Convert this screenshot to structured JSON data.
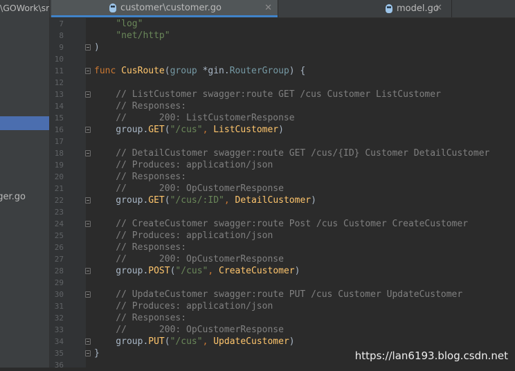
{
  "sidebar": {
    "path_fragment": "\\GOWork\\sr",
    "file_fragment": "ger.go"
  },
  "tabs": [
    {
      "label": "customer\\customer.go",
      "active": true,
      "close": "✕"
    },
    {
      "label": "model.go",
      "active": false,
      "close": "✕"
    }
  ],
  "editor": {
    "lines": [
      {
        "num": "7",
        "fold": false,
        "tokens": [
          {
            "t": "    ",
            "c": "txt"
          },
          {
            "t": "\"log\"",
            "c": "str"
          }
        ]
      },
      {
        "num": "8",
        "fold": false,
        "tokens": [
          {
            "t": "    ",
            "c": "txt"
          },
          {
            "t": "\"net/http\"",
            "c": "str"
          }
        ]
      },
      {
        "num": "9",
        "fold": true,
        "tokens": [
          {
            "t": ")",
            "c": "txt"
          }
        ]
      },
      {
        "num": "10",
        "fold": false,
        "tokens": []
      },
      {
        "num": "11",
        "fold": true,
        "tokens": [
          {
            "t": "func ",
            "c": "kw"
          },
          {
            "t": "CusRoute",
            "c": "fn"
          },
          {
            "t": "(",
            "c": "txt"
          },
          {
            "t": "group ",
            "c": "type"
          },
          {
            "t": "*gin.",
            "c": "txt"
          },
          {
            "t": "RouterGroup",
            "c": "type"
          },
          {
            "t": ") {",
            "c": "txt"
          }
        ]
      },
      {
        "num": "12",
        "fold": false,
        "tokens": []
      },
      {
        "num": "13",
        "fold": true,
        "tokens": [
          {
            "t": "    // ListCustomer swagger:route GET /cus Customer ListCustomer",
            "c": "cm"
          }
        ]
      },
      {
        "num": "14",
        "fold": false,
        "tokens": [
          {
            "t": "    // Responses:",
            "c": "cm"
          }
        ]
      },
      {
        "num": "15",
        "fold": false,
        "tokens": [
          {
            "t": "    //      200: ListCustomerResponse",
            "c": "cm"
          }
        ]
      },
      {
        "num": "16",
        "fold": true,
        "tokens": [
          {
            "t": "    group.",
            "c": "txt"
          },
          {
            "t": "GET",
            "c": "fn"
          },
          {
            "t": "(",
            "c": "txt"
          },
          {
            "t": "\"/cus\"",
            "c": "str"
          },
          {
            "t": ", ",
            "c": "kw"
          },
          {
            "t": "ListCustomer",
            "c": "fn"
          },
          {
            "t": ")",
            "c": "txt"
          }
        ]
      },
      {
        "num": "17",
        "fold": false,
        "tokens": []
      },
      {
        "num": "18",
        "fold": true,
        "tokens": [
          {
            "t": "    // DetailCustomer swagger:route GET /cus/{ID} Customer DetailCustomer",
            "c": "cm"
          }
        ]
      },
      {
        "num": "19",
        "fold": false,
        "tokens": [
          {
            "t": "    // Produces: application/json",
            "c": "cm"
          }
        ]
      },
      {
        "num": "20",
        "fold": false,
        "tokens": [
          {
            "t": "    // Responses:",
            "c": "cm"
          }
        ]
      },
      {
        "num": "21",
        "fold": false,
        "tokens": [
          {
            "t": "    //      200: OpCustomerResponse",
            "c": "cm"
          }
        ]
      },
      {
        "num": "22",
        "fold": true,
        "tokens": [
          {
            "t": "    group.",
            "c": "txt"
          },
          {
            "t": "GET",
            "c": "fn"
          },
          {
            "t": "(",
            "c": "txt"
          },
          {
            "t": "\"/cus/:ID\"",
            "c": "str"
          },
          {
            "t": ", ",
            "c": "kw"
          },
          {
            "t": "DetailCustomer",
            "c": "fn"
          },
          {
            "t": ")",
            "c": "txt"
          }
        ]
      },
      {
        "num": "23",
        "fold": false,
        "tokens": []
      },
      {
        "num": "24",
        "fold": true,
        "tokens": [
          {
            "t": "    // CreateCustomer swagger:route Post /cus Customer CreateCustomer",
            "c": "cm"
          }
        ]
      },
      {
        "num": "25",
        "fold": false,
        "tokens": [
          {
            "t": "    // Produces: application/json",
            "c": "cm"
          }
        ]
      },
      {
        "num": "26",
        "fold": false,
        "tokens": [
          {
            "t": "    // Responses:",
            "c": "cm"
          }
        ]
      },
      {
        "num": "27",
        "fold": false,
        "tokens": [
          {
            "t": "    //      200: OpCustomerResponse",
            "c": "cm"
          }
        ]
      },
      {
        "num": "28",
        "fold": true,
        "tokens": [
          {
            "t": "    group.",
            "c": "txt"
          },
          {
            "t": "POST",
            "c": "fn"
          },
          {
            "t": "(",
            "c": "txt"
          },
          {
            "t": "\"/cus\"",
            "c": "str"
          },
          {
            "t": ", ",
            "c": "kw"
          },
          {
            "t": "CreateCustomer",
            "c": "fn"
          },
          {
            "t": ")",
            "c": "txt"
          }
        ]
      },
      {
        "num": "29",
        "fold": false,
        "tokens": []
      },
      {
        "num": "30",
        "fold": true,
        "tokens": [
          {
            "t": "    // UpdateCustomer swagger:route PUT /cus Customer UpdateCustomer",
            "c": "cm"
          }
        ]
      },
      {
        "num": "31",
        "fold": false,
        "tokens": [
          {
            "t": "    // Produces: application/json",
            "c": "cm"
          }
        ]
      },
      {
        "num": "32",
        "fold": false,
        "tokens": [
          {
            "t": "    // Responses:",
            "c": "cm"
          }
        ]
      },
      {
        "num": "33",
        "fold": false,
        "tokens": [
          {
            "t": "    //      200: OpCustomerResponse",
            "c": "cm"
          }
        ]
      },
      {
        "num": "34",
        "fold": true,
        "tokens": [
          {
            "t": "    group.",
            "c": "txt"
          },
          {
            "t": "PUT",
            "c": "fn"
          },
          {
            "t": "(",
            "c": "txt"
          },
          {
            "t": "\"/cus\"",
            "c": "str"
          },
          {
            "t": ", ",
            "c": "kw"
          },
          {
            "t": "UpdateCustomer",
            "c": "fn"
          },
          {
            "t": ")",
            "c": "txt"
          }
        ]
      },
      {
        "num": "35",
        "fold": true,
        "tokens": [
          {
            "t": "}",
            "c": "txt"
          }
        ]
      },
      {
        "num": "36",
        "fold": false,
        "tokens": []
      }
    ]
  },
  "watermark": "https://lan6193.blog.csdn.net",
  "colors": {
    "background": "#2b2b2b",
    "keyword": "#cc7832",
    "function": "#ffc66d",
    "string": "#6a8759",
    "comment": "#808080",
    "text": "#a9b7c6",
    "selection": "#4b6eaf"
  }
}
